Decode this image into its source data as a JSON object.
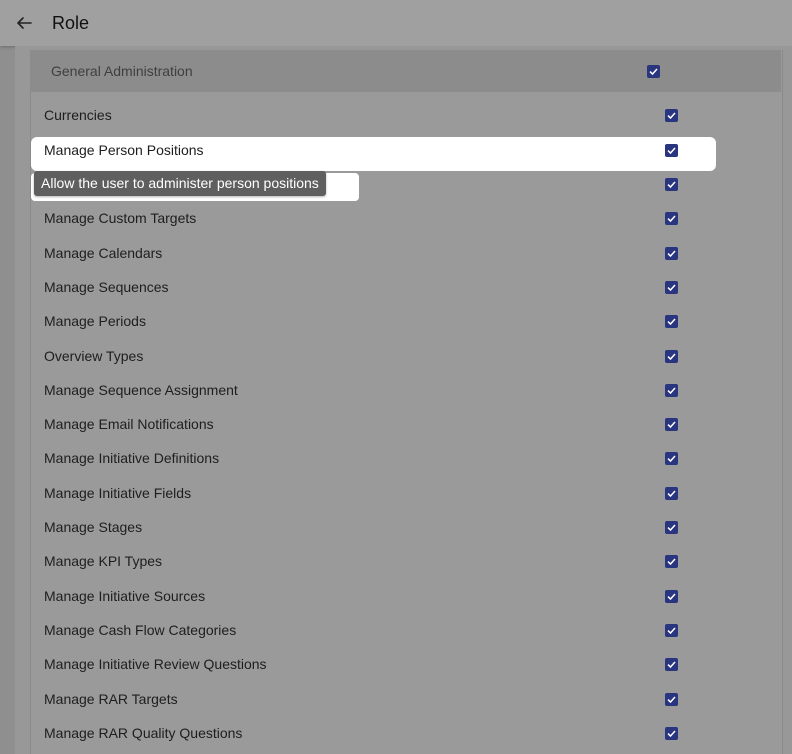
{
  "header": {
    "title": "Role",
    "back_icon": "arrow-back-icon"
  },
  "group": {
    "label": "General Administration",
    "checked": true
  },
  "tooltip": {
    "text": "Allow the user to administer person positions"
  },
  "permissions": [
    {
      "label": "Currencies",
      "checked": true
    },
    {
      "label": "Manage Person Positions",
      "checked": true
    },
    {
      "label": "",
      "checked": true
    },
    {
      "label": "Manage Custom Targets",
      "checked": true
    },
    {
      "label": "Manage Calendars",
      "checked": true
    },
    {
      "label": "Manage Sequences",
      "checked": true
    },
    {
      "label": "Manage Periods",
      "checked": true
    },
    {
      "label": "Overview Types",
      "checked": true
    },
    {
      "label": "Manage Sequence Assignment",
      "checked": true
    },
    {
      "label": "Manage Email Notifications",
      "checked": true
    },
    {
      "label": "Manage Initiative Definitions",
      "checked": true
    },
    {
      "label": "Manage Initiative Fields",
      "checked": true
    },
    {
      "label": "Manage Stages",
      "checked": true
    },
    {
      "label": "Manage KPI Types",
      "checked": true
    },
    {
      "label": "Manage Initiative Sources",
      "checked": true
    },
    {
      "label": "Manage Cash Flow Categories",
      "checked": true
    },
    {
      "label": "Manage Initiative Review Questions",
      "checked": true
    },
    {
      "label": "Manage RAR Targets",
      "checked": true
    },
    {
      "label": "Manage RAR Quality Questions",
      "checked": true
    }
  ],
  "colors": {
    "checkbox": "#2a3580",
    "overlay": "#8f8f8f",
    "highlight": "#ffffff"
  }
}
